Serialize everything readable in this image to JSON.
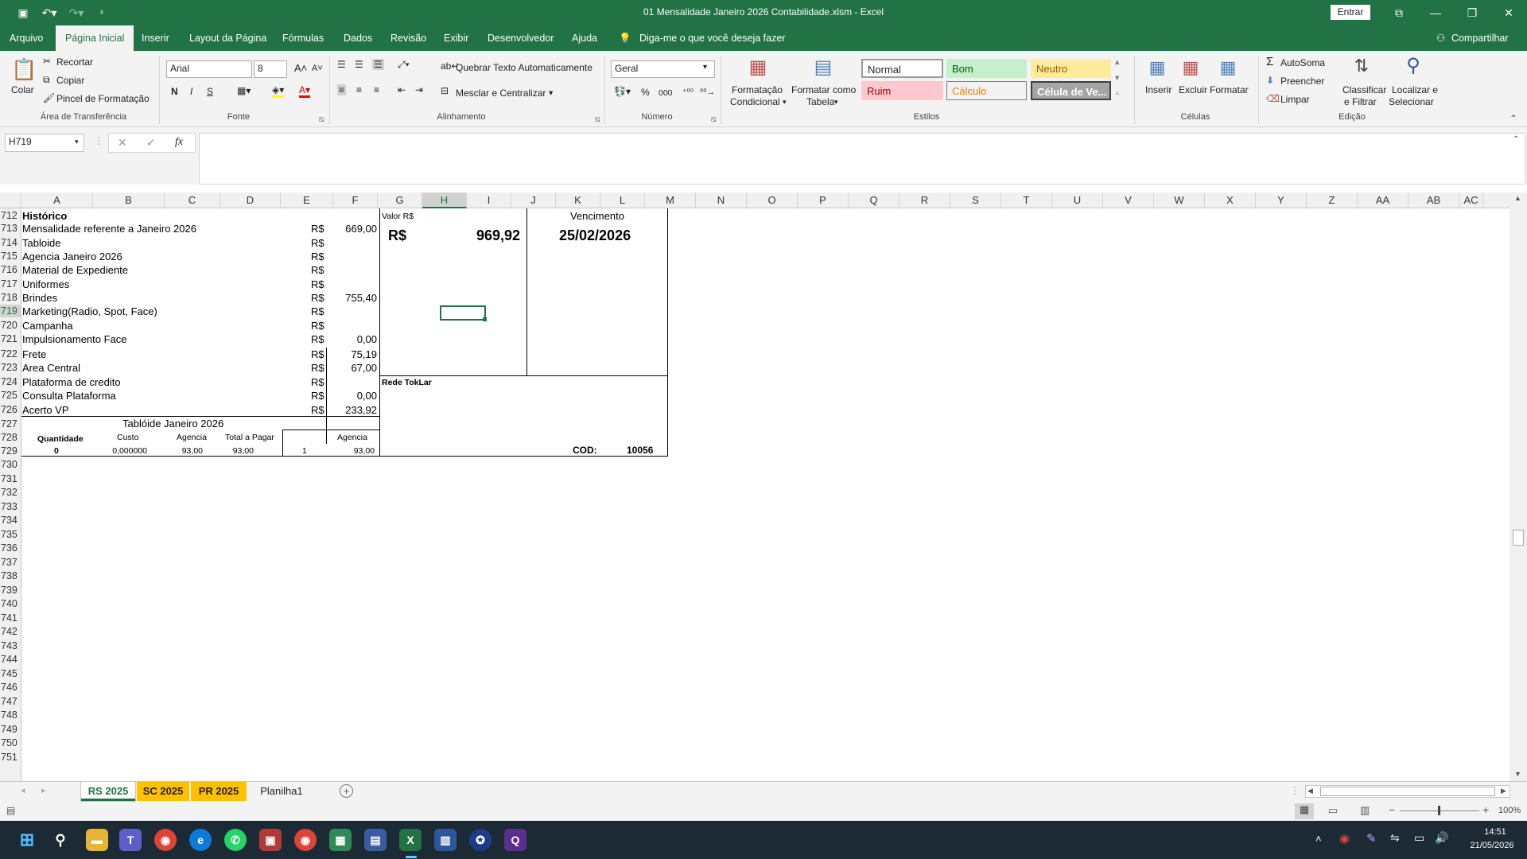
{
  "title": "01 Mensalidade Janeiro 2026 Contabilidade.xlsm  -  Excel",
  "signin_label": "Entrar",
  "menu": {
    "file": "Arquivo",
    "home": "Página Inicial",
    "insert": "Inserir",
    "layout": "Layout da Página",
    "formulas": "Fórmulas",
    "data": "Dados",
    "review": "Revisão",
    "view": "Exibir",
    "developer": "Desenvolvedor",
    "help": "Ajuda",
    "tellme": "Diga-me o que você deseja fazer",
    "share": "Compartilhar"
  },
  "ribbon": {
    "paste": "Colar",
    "cut": "Recortar",
    "copy": "Copiar",
    "format_painter": "Pincel de Formatação",
    "clipboard": "Área de Transferência",
    "font_name": "Arial",
    "font_size": "8",
    "bold": "N",
    "italic": "I",
    "underline": "S",
    "font_group": "Fonte",
    "wrap_text": "Quebrar Texto Automaticamente",
    "merge_center": "Mesclar e Centralizar",
    "alignment": "Alinhamento",
    "number_format": "Geral",
    "number_group": "Número",
    "cond_format_1": "Formatação",
    "cond_format_2": "Condicional",
    "format_table_1": "Formatar como",
    "format_table_2": "Tabela",
    "style_normal": "Normal",
    "style_good": "Bom",
    "style_neutral": "Neutro",
    "style_bad": "Ruim",
    "style_calc": "Cálculo",
    "style_check": "Célula de Ve...",
    "styles_group": "Estilos",
    "insert": "Inserir",
    "delete": "Excluir",
    "format": "Formatar",
    "cells_group": "Células",
    "autosum": "AutoSoma",
    "fill": "Preencher",
    "clear": "Limpar",
    "sort_1": "Classificar",
    "sort_2": "e Filtrar",
    "find_1": "Localizar e",
    "find_2": "Selecionar",
    "editing_group": "Edição"
  },
  "namebox": "H719",
  "fx": "fx",
  "columns": [
    "A",
    "B",
    "C",
    "D",
    "E",
    "F",
    "G",
    "H",
    "I",
    "J",
    "K",
    "L",
    "M",
    "N",
    "O",
    "P",
    "Q",
    "R",
    "S",
    "T",
    "U",
    "V",
    "W",
    "X",
    "Y",
    "Z",
    "AA",
    "AB",
    "AC"
  ],
  "rows": [
    "712",
    "713",
    "714",
    "715",
    "716",
    "717",
    "718",
    "719",
    "720",
    "721",
    "722",
    "723",
    "724",
    "725",
    "726",
    "727",
    "728",
    "729",
    "730",
    "731",
    "732",
    "733",
    "734",
    "735",
    "736",
    "737",
    "738",
    "739",
    "740",
    "741",
    "742",
    "743",
    "744",
    "745",
    "746",
    "747",
    "748",
    "749",
    "750",
    "751"
  ],
  "sheet": {
    "historico": "Histórico",
    "items": [
      {
        "label": "Mensalidade referente a Janeiro 2026",
        "cur": "R$",
        "value": "669,00"
      },
      {
        "label": "Tabloide",
        "cur": "R$",
        "value": ""
      },
      {
        "label": "Agencia Janeiro 2026",
        "cur": "R$",
        "value": ""
      },
      {
        "label": "Material de Expediente",
        "cur": "R$",
        "value": ""
      },
      {
        "label": "Uniformes",
        "cur": "R$",
        "value": ""
      },
      {
        "label": "Brindes",
        "cur": "R$",
        "value": "755,40"
      },
      {
        "label": "Marketing(Radio, Spot, Face)",
        "cur": "R$",
        "value": ""
      },
      {
        "label": "Campanha",
        "cur": "R$",
        "value": ""
      },
      {
        "label": "Impulsionamento Face",
        "cur": "R$",
        "value": "0,00"
      },
      {
        "label": "Frete",
        "cur": "R$",
        "value": "75,19"
      },
      {
        "label": "Area Central",
        "cur": "R$",
        "value": "67,00"
      },
      {
        "label": "Plataforma de credito",
        "cur": "R$",
        "value": ""
      },
      {
        "label": "Consulta Plataforma",
        "cur": "R$",
        "value": "0,00"
      },
      {
        "label": "Acerto VP",
        "cur": "R$",
        "value": "233,92"
      }
    ],
    "tabloid_title": "Tablóide Janeiro 2026",
    "tabloid_headers": {
      "qty": "Quantidade",
      "cost": "Custo",
      "agency": "Agencia",
      "total": "Total a Pagar",
      "agency2": "Agencia"
    },
    "tabloid_values": {
      "qty": "0",
      "cost": "0,000000",
      "agency": "93,00",
      "total": "93,00",
      "one": "1",
      "agency2": "93,00"
    },
    "valor_label": "Valor R$",
    "valor_cur": "R$",
    "valor_amount": "969,92",
    "vencimento_label": "Vencimento",
    "vencimento_date": "25/02/2026",
    "rede": "Rede TokLar",
    "cod_label": "COD:",
    "cod_value": "10056"
  },
  "tabs": [
    {
      "label": "RS 2025",
      "color": "#ffffff",
      "active": true
    },
    {
      "label": "SC 2025",
      "color": "#ffc000",
      "active": false
    },
    {
      "label": "PR 2025",
      "color": "#ffc000",
      "active": false
    },
    {
      "label": "Planilha1",
      "color": "#f3f3f3",
      "active": false
    }
  ],
  "zoom": "100%",
  "clock": {
    "time": "14:51",
    "date": "21/05/2026"
  },
  "colors": {
    "excel_green": "#217346",
    "taskbar": "#1c2a36"
  }
}
